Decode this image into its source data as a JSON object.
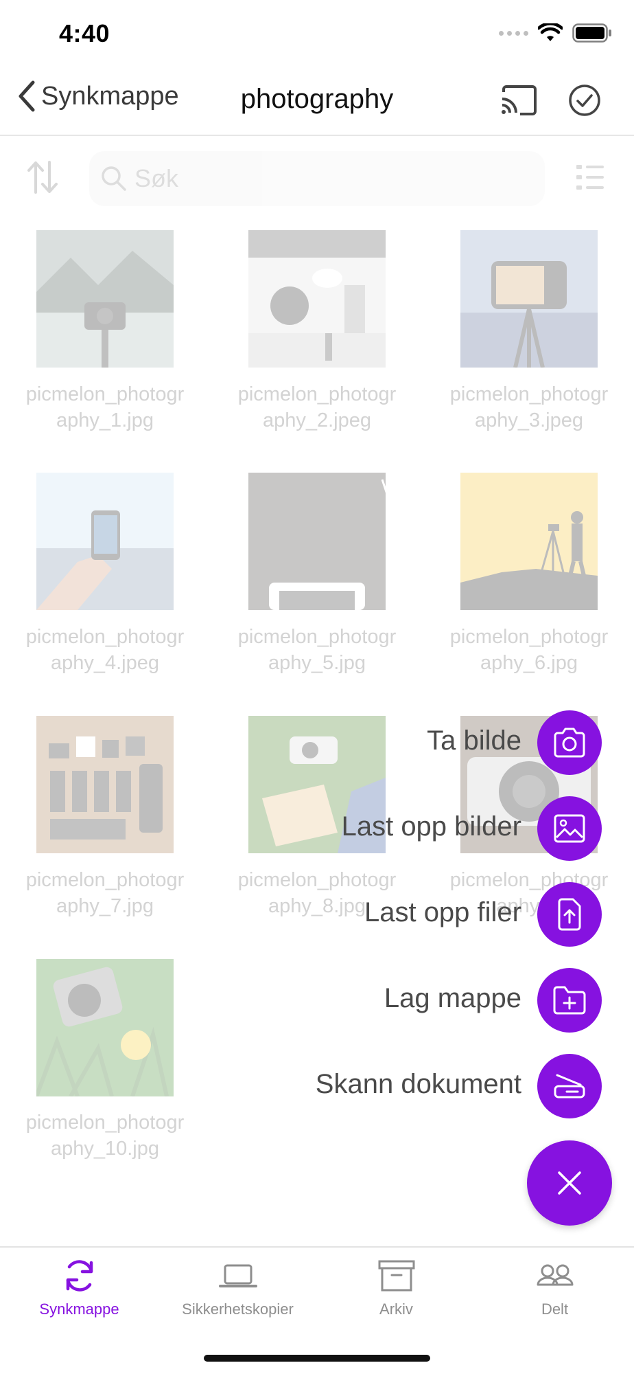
{
  "status": {
    "time": "4:40"
  },
  "nav": {
    "back_label": "Synkmappe",
    "title": "photography"
  },
  "search": {
    "placeholder": "Søk"
  },
  "files": [
    {
      "name": "picmelon_photography_1.jpg",
      "line1": "picmelon_photogr",
      "line2": "aphy_1.jpg"
    },
    {
      "name": "picmelon_photography_2.jpeg",
      "line1": "picmelon_photogr",
      "line2": "aphy_2.jpeg"
    },
    {
      "name": "picmelon_photography_3.jpeg",
      "line1": "picmelon_photogr",
      "line2": "aphy_3.jpeg"
    },
    {
      "name": "picmelon_photography_4.jpeg",
      "line1": "picmelon_photogr",
      "line2": "aphy_4.jpeg"
    },
    {
      "name": "picmelon_photography_5.jpg",
      "line1": "picmelon_photogr",
      "line2": "aphy_5.jpg"
    },
    {
      "name": "picmelon_photography_6.jpg",
      "line1": "picmelon_photogr",
      "line2": "aphy_6.jpg"
    },
    {
      "name": "picmelon_photography_7.jpg",
      "line1": "picmelon_photogr",
      "line2": "aphy_7.jpg"
    },
    {
      "name": "picmelon_photography_8.jpg",
      "line1": "picmelon_photogr",
      "line2": "aphy_8.jpg"
    },
    {
      "name": "picmelon_photography_9",
      "line1": "picmelon_photogr",
      "line2": "aphy_9"
    },
    {
      "name": "picmelon_photography_10.jpg",
      "line1": "picmelon_photogr",
      "line2": "aphy_10.jpg"
    }
  ],
  "fab_menu": {
    "take_photo": "Ta bilde",
    "upload_photos": "Last opp bilder",
    "upload_files": "Last opp filer",
    "create_folder": "Lag mappe",
    "scan_document": "Skann dokument"
  },
  "tabs": [
    {
      "label": "Synkmappe",
      "icon": "sync-icon",
      "active": true
    },
    {
      "label": "Sikkerhetskopier",
      "icon": "laptop-icon",
      "active": false
    },
    {
      "label": "Arkiv",
      "icon": "archive-icon",
      "active": false
    },
    {
      "label": "Delt",
      "icon": "people-icon",
      "active": false
    }
  ],
  "colors": {
    "accent": "#8612e0",
    "inactive_tab": "#8e8e8e"
  }
}
